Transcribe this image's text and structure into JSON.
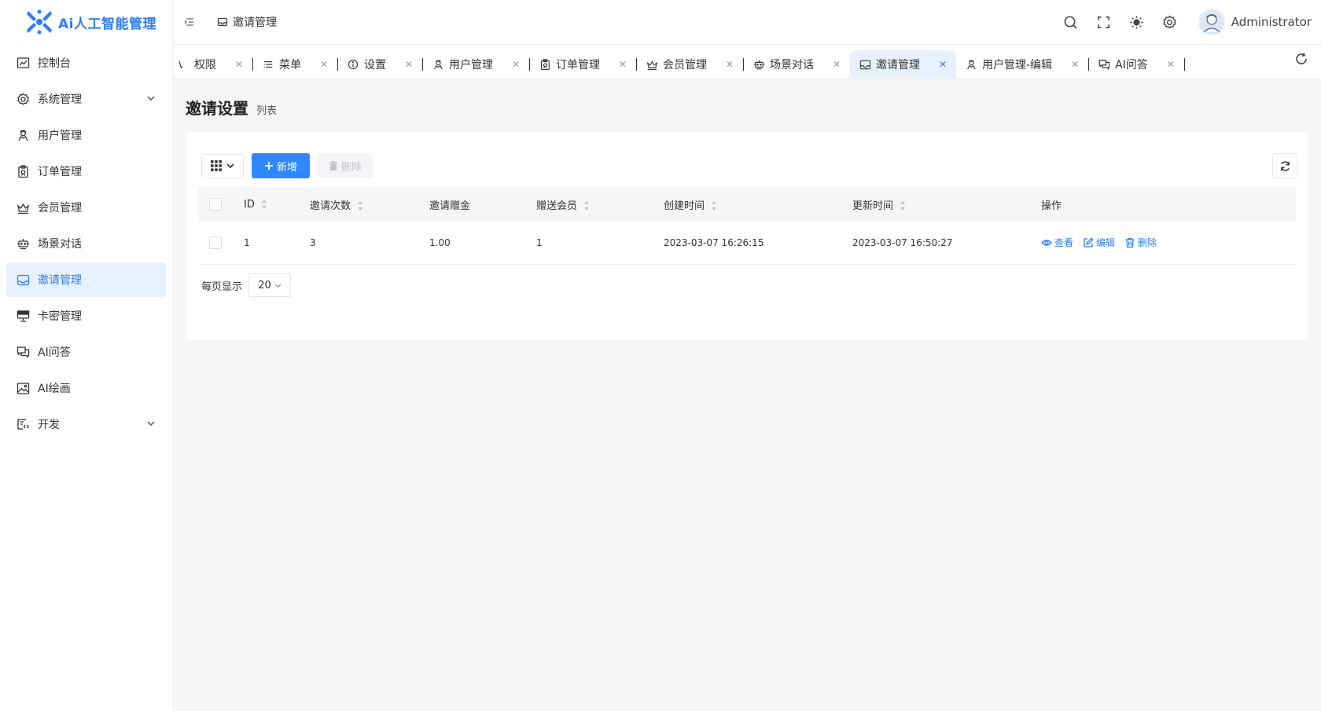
{
  "app": {
    "logo_text": "Ai人工智能管理",
    "accent_color": "#2f7df6"
  },
  "sidebar": {
    "items": [
      {
        "label": "控制台",
        "icon": "dashboard-icon"
      },
      {
        "label": "系统管理",
        "icon": "gear-icon",
        "expandable": true
      },
      {
        "label": "用户管理",
        "icon": "user-icon"
      },
      {
        "label": "订单管理",
        "icon": "clipboard-icon"
      },
      {
        "label": "会员管理",
        "icon": "crown-icon"
      },
      {
        "label": "场景对话",
        "icon": "robot-icon"
      },
      {
        "label": "邀请管理",
        "icon": "inbox-icon",
        "active": true
      },
      {
        "label": "卡密管理",
        "icon": "monitor-icon"
      },
      {
        "label": "AI问答",
        "icon": "chat-icon"
      },
      {
        "label": "AI绘画",
        "icon": "image-icon"
      },
      {
        "label": "开发",
        "icon": "code-icon",
        "expandable": true
      }
    ]
  },
  "header": {
    "breadcrumb": "邀请管理",
    "username": "Administrator"
  },
  "tabs": [
    {
      "label": "权限",
      "icon": "key-icon"
    },
    {
      "label": "菜单",
      "icon": "list-icon"
    },
    {
      "label": "设置",
      "icon": "info-icon"
    },
    {
      "label": "用户管理",
      "icon": "user-icon"
    },
    {
      "label": "订单管理",
      "icon": "clipboard-icon"
    },
    {
      "label": "会员管理",
      "icon": "crown-icon"
    },
    {
      "label": "场景对话",
      "icon": "robot-icon"
    },
    {
      "label": "邀请管理",
      "icon": "inbox-icon",
      "active": true
    },
    {
      "label": "用户管理-编辑",
      "icon": "user-icon"
    },
    {
      "label": "AI问答",
      "icon": "chat-icon"
    }
  ],
  "page": {
    "title": "邀请设置",
    "subtitle": "列表"
  },
  "toolbar": {
    "add_label": "新增",
    "delete_label": "删除"
  },
  "table": {
    "columns": [
      "ID",
      "邀请次数",
      "邀请赠金",
      "赠送会员",
      "创建时间",
      "更新时间",
      "操作"
    ],
    "rows": [
      {
        "id": "1",
        "invite_count": "3",
        "bonus": "1.00",
        "vip": "1",
        "created": "2023-03-07 16:26:15",
        "updated": "2023-03-07 16:50:27"
      }
    ],
    "actions": {
      "view": "查看",
      "edit": "编辑",
      "delete": "删除"
    }
  },
  "pager": {
    "label": "每页显示",
    "page_size": "20"
  }
}
